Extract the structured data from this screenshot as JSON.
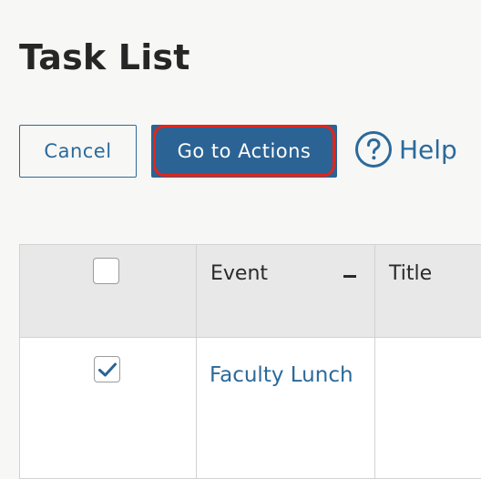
{
  "page": {
    "title": "Task List"
  },
  "toolbar": {
    "cancel_label": "Cancel",
    "actions_label": "Go to Actions",
    "help_label": "Help"
  },
  "table": {
    "columns": [
      "",
      "Event",
      "Title"
    ],
    "header_checkbox_checked": false,
    "rows": [
      {
        "checked": true,
        "event": "Faculty Lunch",
        "title": ""
      }
    ]
  },
  "colors": {
    "accent": "#2b6394",
    "link": "#2b6a9a",
    "highlight_outline": "#e2261b",
    "header_bg": "#e8e8e8"
  },
  "icons": {
    "help": "question-circle-icon",
    "collapse": "minus-icon",
    "check": "checkmark-icon"
  }
}
